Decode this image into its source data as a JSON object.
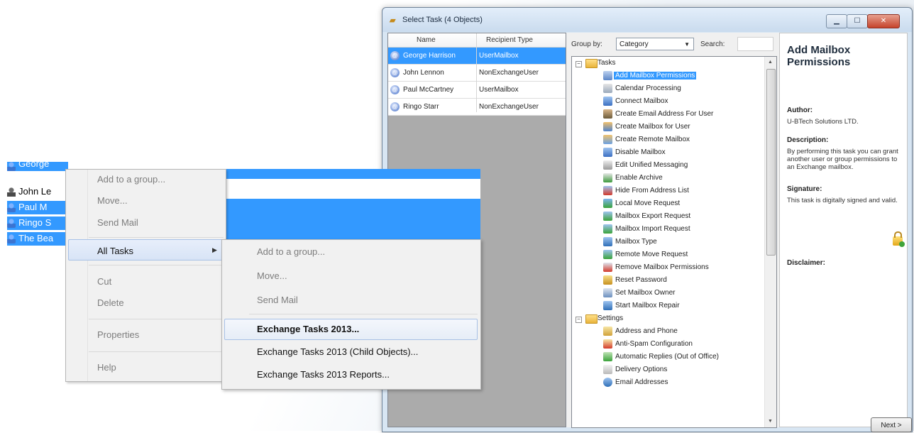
{
  "window": {
    "title": "Select Task (4 Objects)",
    "buttons": {
      "minimize": "▁",
      "maximize": "☐",
      "close": "✕"
    }
  },
  "objects_grid": {
    "columns": [
      "Name",
      "Recipient Type"
    ],
    "rows": [
      {
        "name": "George Harrison",
        "type": "UserMailbox",
        "selected": true
      },
      {
        "name": "John Lennon",
        "type": "NonExchangeUser",
        "selected": false
      },
      {
        "name": "Paul McCartney",
        "type": "UserMailbox",
        "selected": false
      },
      {
        "name": "Ringo Starr",
        "type": "NonExchangeUser",
        "selected": false
      }
    ]
  },
  "task_panel": {
    "group_by_label": "Group by:",
    "group_by_value": "Category",
    "search_label": "Search:",
    "search_value": "",
    "tree": {
      "tasks_folder": "Tasks",
      "tasks": [
        "Add Mailbox Permissions",
        "Calendar Processing",
        "Connect Mailbox",
        "Create Email Address For User",
        "Create Mailbox for User",
        "Create Remote Mailbox",
        "Disable Mailbox",
        "Edit Unified Messaging",
        "Enable Archive",
        "Hide From Address List",
        "Local Move Request",
        "Mailbox Export Request",
        "Mailbox Import Request",
        "Mailbox Type",
        "Remote Move Request",
        "Remove Mailbox Permissions",
        "Reset Password",
        "Set Mailbox Owner",
        "Start Mailbox Repair"
      ],
      "settings_folder": "Settings",
      "settings": [
        "Address and Phone",
        "Anti-Spam Configuration",
        "Automatic Replies (Out of Office)",
        "Delivery Options",
        "Email Addresses"
      ]
    }
  },
  "info_panel": {
    "title": "Add Mailbox Permissions",
    "author_label": "Author:",
    "author": "U-BTech Solutions LTD.",
    "description_label": "Description:",
    "description": "By performing this task you can grant another user or group permissions to an Exchange mailbox.",
    "signature_label": "Signature:",
    "signature": "This task is digitally signed and valid.",
    "disclaimer_label": "Disclaimer:"
  },
  "next_button": "Next >",
  "background_list": {
    "items": [
      {
        "label": "George",
        "selected": true
      },
      {
        "label": "John Le",
        "selected": false
      },
      {
        "label": "Paul M",
        "selected": true
      },
      {
        "label": "Ringo S",
        "selected": true
      },
      {
        "label": "The Bea",
        "selected": true
      }
    ]
  },
  "context_menu": {
    "items": {
      "add_to_group": "Add to a group...",
      "move": "Move...",
      "send_mail": "Send Mail",
      "all_tasks": "All Tasks",
      "cut": "Cut",
      "delete": "Delete",
      "properties": "Properties",
      "help": "Help"
    }
  },
  "submenu": {
    "items": {
      "add_to_group": "Add to a group...",
      "move": "Move...",
      "send_mail": "Send Mail",
      "exchange_tasks": "Exchange Tasks 2013...",
      "exchange_tasks_child": "Exchange Tasks 2013 (Child Objects)...",
      "exchange_tasks_reports": "Exchange Tasks 2013 Reports..."
    }
  },
  "colors": {
    "selection": "#3399ff",
    "window_frame": "#d8e6f3"
  }
}
